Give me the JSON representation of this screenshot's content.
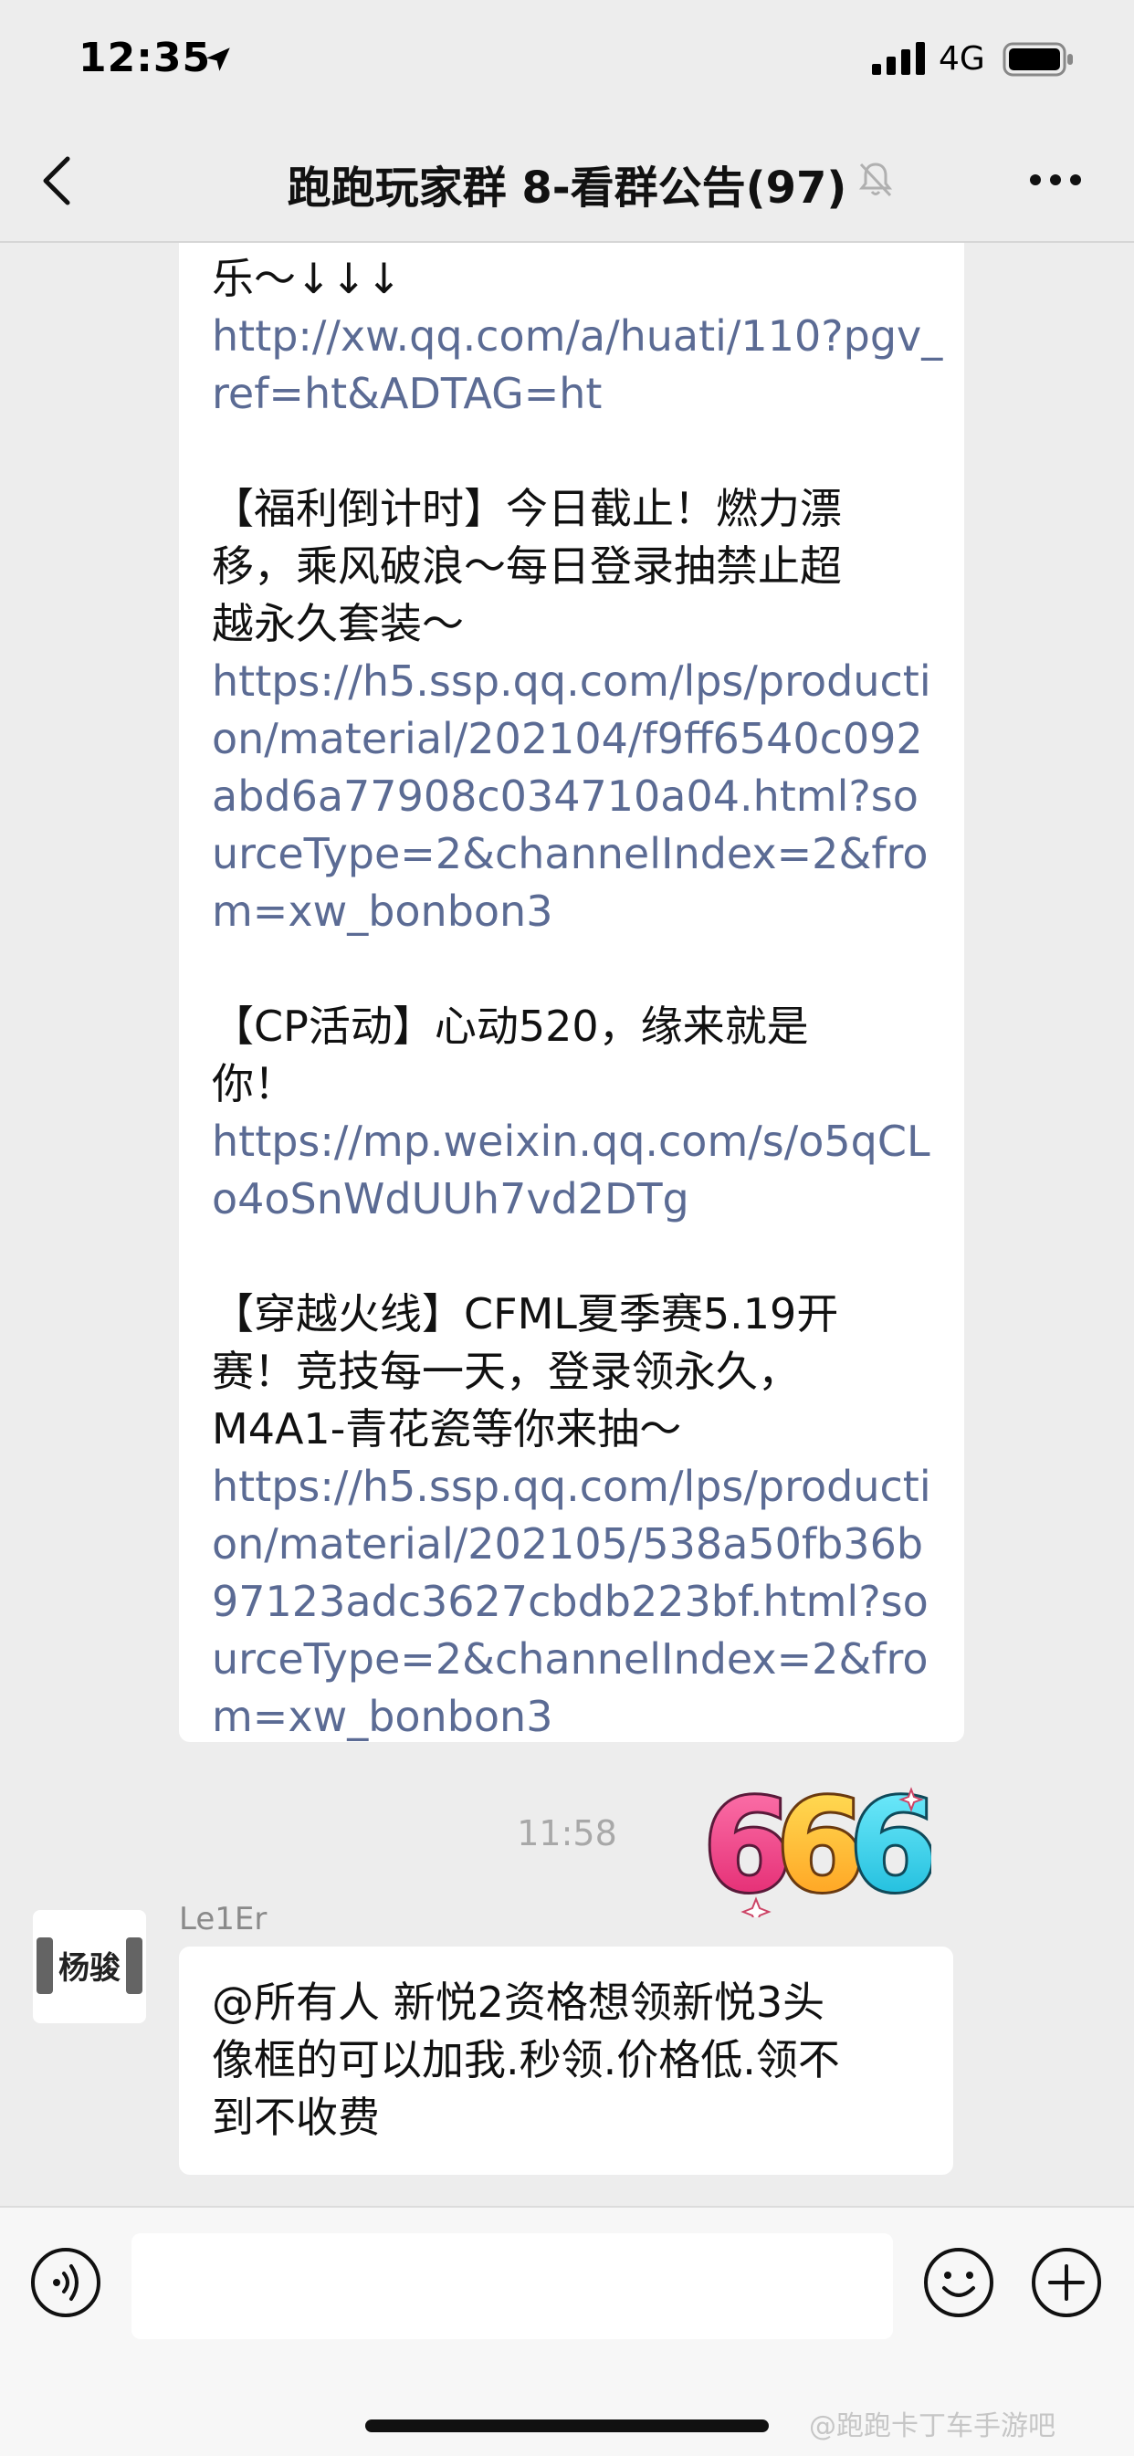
{
  "status_bar": {
    "time": "12:35",
    "network": "4G"
  },
  "nav": {
    "title": "跑跑玩家群 8-看群公告(97)"
  },
  "messages": {
    "announcement_lines": [
      {
        "text": "乐～↓↓↓",
        "type": "text"
      },
      {
        "text": "http://xw.qq.com/a/huati/110?pgv_",
        "type": "link"
      },
      {
        "text": "ref=ht&ADTAG=ht",
        "type": "link"
      },
      {
        "text": "",
        "type": "blank"
      },
      {
        "text": "【福利倒计时】今日截止！燃力漂",
        "type": "text"
      },
      {
        "text": "移，乘风破浪～每日登录抽禁止超",
        "type": "text"
      },
      {
        "text": "越永久套装～",
        "type": "text"
      },
      {
        "text": "https://h5.ssp.qq.com/lps/producti",
        "type": "link"
      },
      {
        "text": "on/material/202104/f9ff6540c092",
        "type": "link"
      },
      {
        "text": "abd6a77908c034710a04.html?so",
        "type": "link"
      },
      {
        "text": "urceType=2&channelIndex=2&fro",
        "type": "link"
      },
      {
        "text": "m=xw_bonbon3",
        "type": "link"
      },
      {
        "text": "",
        "type": "blank"
      },
      {
        "text": "【CP活动】心动520，缘来就是",
        "type": "text"
      },
      {
        "text": "你！",
        "type": "text"
      },
      {
        "text": "https://mp.weixin.qq.com/s/o5qCL",
        "type": "link"
      },
      {
        "text": "o4oSnWdUUh7vd2DTg",
        "type": "link"
      },
      {
        "text": "",
        "type": "blank"
      },
      {
        "text": "【穿越火线】CFML夏季赛5.19开",
        "type": "text"
      },
      {
        "text": "赛！竞技每一天，登录领永久，",
        "type": "text"
      },
      {
        "text": "M4A1-青花瓷等你来抽～",
        "type": "text"
      },
      {
        "text": "https://h5.ssp.qq.com/lps/producti",
        "type": "link"
      },
      {
        "text": "on/material/202105/538a50fb36b",
        "type": "link"
      },
      {
        "text": "97123adc3627cbdb223bf.html?so",
        "type": "link"
      },
      {
        "text": "urceType=2&channelIndex=2&fro",
        "type": "link"
      },
      {
        "text": "m=xw_bonbon3",
        "type": "link"
      }
    ],
    "timestamp": "11:58",
    "sticker_text": "666",
    "second": {
      "sender": "Le1Er",
      "avatar_text": "杨骏",
      "lines": [
        "@所有人 新悦2资格想领新悦3头",
        "像框的可以加我.秒领.价格低.领不",
        "到不收费"
      ]
    }
  },
  "input_bar": {
    "value": "",
    "placeholder": ""
  },
  "watermark": "@跑跑卡丁车手游吧",
  "colors": {
    "link": "#5b6b94",
    "background": "#ededed",
    "bubble": "#ffffff"
  },
  "icons": [
    "location-arrow-icon",
    "signal-icon",
    "battery-icon",
    "back-icon",
    "mute-bell-icon",
    "more-icon",
    "voice-icon",
    "emoji-icon",
    "plus-icon"
  ]
}
